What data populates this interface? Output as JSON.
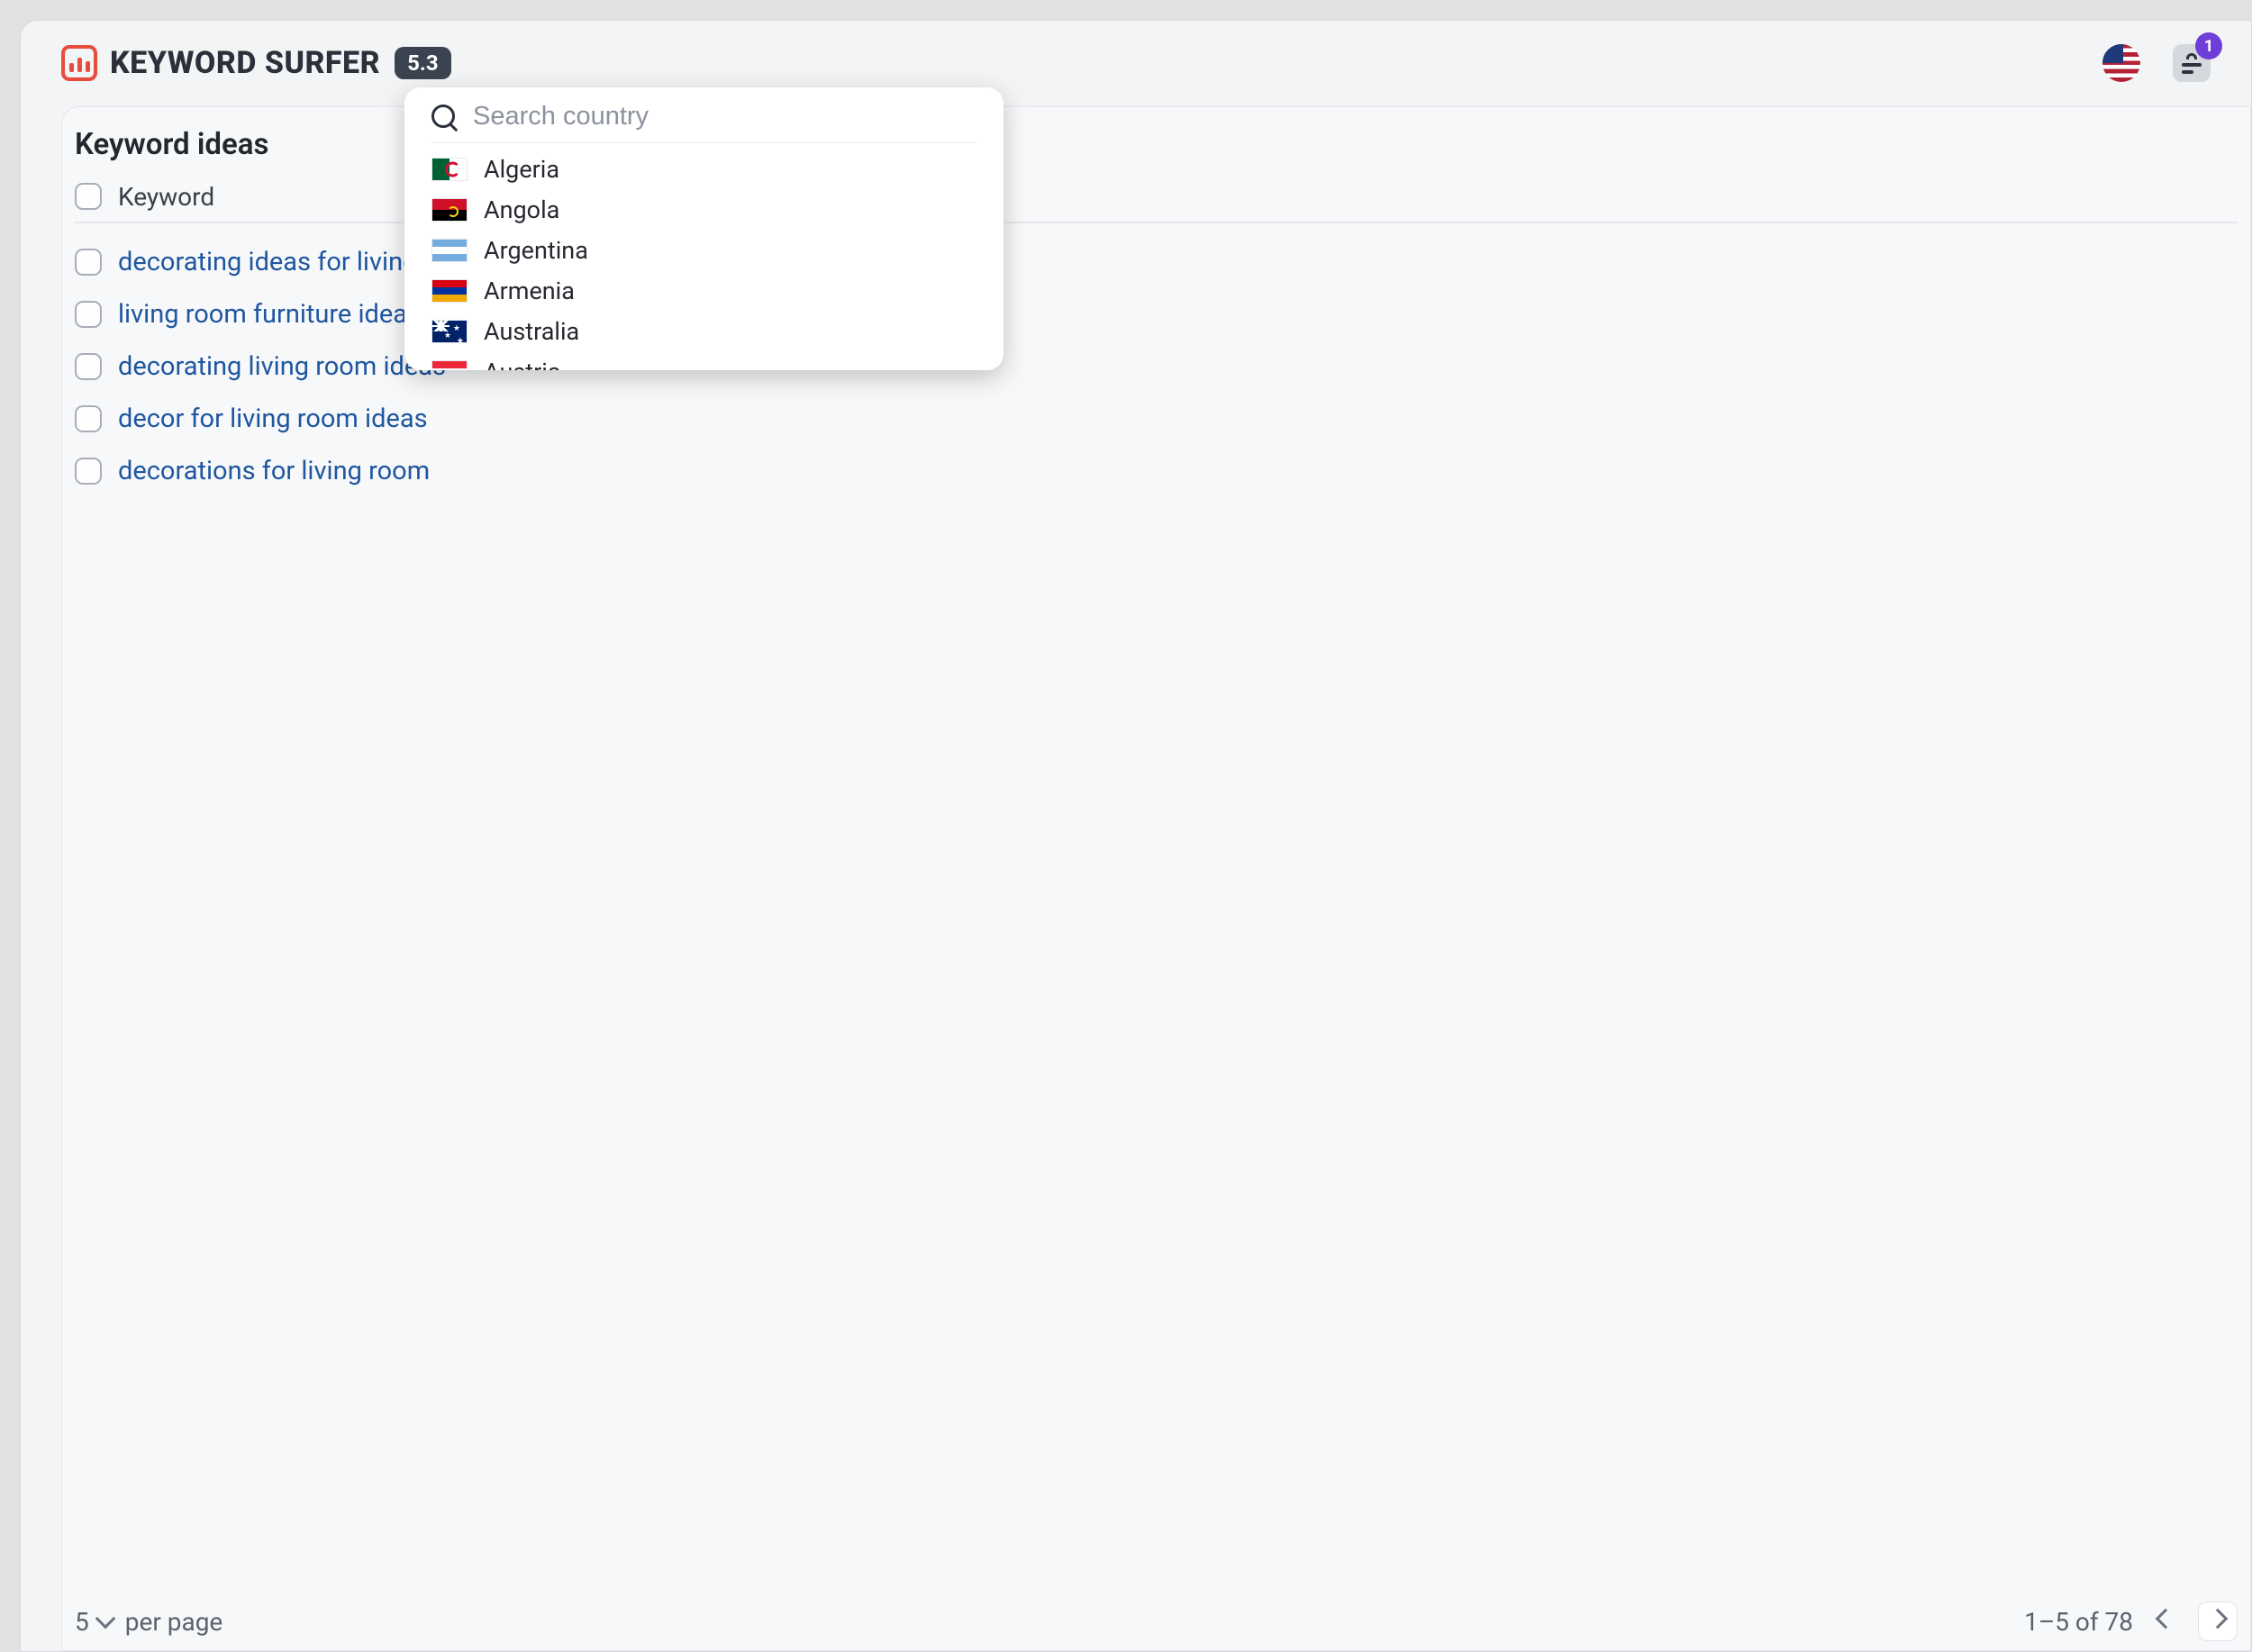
{
  "header": {
    "brand": "KEYWORD SURFER",
    "version": "5.3",
    "badge_count": "1"
  },
  "card": {
    "title": "Keyword ideas",
    "column_label": "Keyword"
  },
  "keywords": [
    "decorating ideas for living room",
    "living room furniture ideas",
    "decorating living room ideas",
    "decor for living room ideas",
    "decorations for living room"
  ],
  "pagination": {
    "per_page_value": "5",
    "per_page_label": "per page",
    "range_text": "1–5 of 78"
  },
  "country_search": {
    "placeholder": "Search country"
  },
  "countries": [
    {
      "name": "Algeria",
      "flag_class": "flag-dz"
    },
    {
      "name": "Angola",
      "flag_class": "flag-ao"
    },
    {
      "name": "Argentina",
      "flag_class": "flag-ar"
    },
    {
      "name": "Armenia",
      "flag_class": "flag-am"
    },
    {
      "name": "Australia",
      "flag_class": "flag-au"
    },
    {
      "name": "Austria",
      "flag_class": "flag-at"
    }
  ]
}
